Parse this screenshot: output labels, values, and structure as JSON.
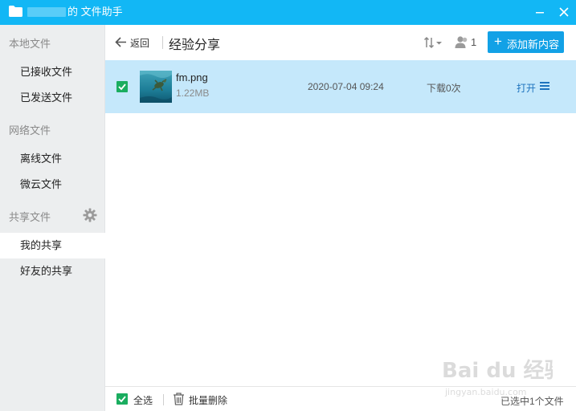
{
  "window": {
    "title": "的 文件助手",
    "icon": "folder-icon",
    "controls": [
      "minimize-icon",
      "close-icon"
    ]
  },
  "sidebar": {
    "groups": [
      {
        "label": "本地文件",
        "items": [
          {
            "label": "已接收文件"
          },
          {
            "label": "已发送文件"
          }
        ]
      },
      {
        "label": "网络文件",
        "items": [
          {
            "label": "离线文件"
          },
          {
            "label": "微云文件"
          }
        ]
      },
      {
        "label": "共享文件",
        "icon": "gear-icon",
        "items": [
          {
            "label": "我的共享",
            "active": true
          },
          {
            "label": "好友的共享"
          }
        ]
      }
    ]
  },
  "header": {
    "back_label": "返回",
    "title": "经验分享",
    "sort_icon": "sort-icon",
    "member_count": "1",
    "add_button_label": "添加新内容"
  },
  "files": [
    {
      "name": "fm.png",
      "size": "1.22MB",
      "date": "2020-07-04 09:24",
      "downloads": "下载0次",
      "open_label": "打开",
      "checked": true,
      "selected": true
    }
  ],
  "footer": {
    "select_all_label": "全选",
    "batch_delete_label": "批量删除",
    "status": "已选中1个文件"
  },
  "watermark": {
    "text": "Bai du 经验",
    "subtext": "jingyan.baidu.com"
  },
  "colors": {
    "titlebar": "#12b7f5",
    "accent": "#12a1e6",
    "row_selected": "#c5e8fb",
    "checkbox": "#1aad5f",
    "link": "#1e73be",
    "sidebar_bg": "#eceeef"
  }
}
